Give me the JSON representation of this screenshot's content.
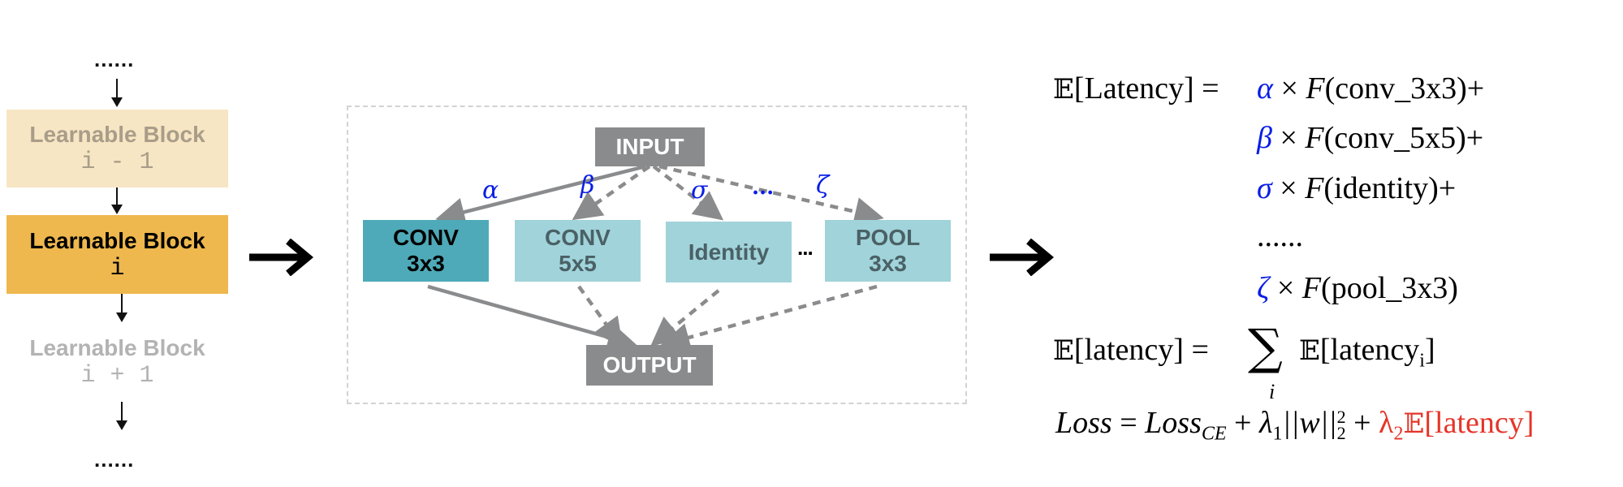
{
  "left_column": {
    "top_ellipsis": "......",
    "bottom_ellipsis": "......",
    "blocks": [
      {
        "title": "Learnable Block",
        "index": "i - 1",
        "state": "previous"
      },
      {
        "title": "Learnable Block",
        "index": "i",
        "state": "current"
      },
      {
        "title": "Learnable Block",
        "index": "i + 1",
        "state": "next"
      }
    ],
    "colors": {
      "previous_fill": "#f7e6c3",
      "current_fill": "#eeb84e"
    }
  },
  "supernet": {
    "input_label": "INPUT",
    "output_label": "OUTPUT",
    "candidate_ops": [
      {
        "line1": "CONV",
        "line2": "3x3",
        "weight_symbol": "α",
        "selected": true
      },
      {
        "line1": "CONV",
        "line2": "5x5",
        "weight_symbol": "β",
        "selected": false
      },
      {
        "line1": "Identity",
        "line2": "",
        "weight_symbol": "σ",
        "selected": false
      },
      {
        "line1": "POOL",
        "line2": "3x3",
        "weight_symbol": "ζ",
        "selected": false
      }
    ],
    "ops_ellipsis": "...",
    "weights_ellipsis": "...",
    "colors": {
      "selected_op": "#4eaab8",
      "unselected_op": "#a1d3da",
      "io_box": "#8a8b8d",
      "edge": "#8a8b8d",
      "weight_text": "#0a1ee6"
    }
  },
  "formulas": {
    "latency_expectation": {
      "lhs_bb": "𝔼",
      "lhs_text": "[Latency] =",
      "terms": [
        {
          "coef": "α",
          "op": "× ",
          "fn": "F",
          "arg": "(conv_3x3)+"
        },
        {
          "coef": "β",
          "op": "× ",
          "fn": "F",
          "arg": "(conv_5x5)+"
        },
        {
          "coef": "σ",
          "op": "× ",
          "fn": "F",
          "arg": "(identity)+"
        },
        {
          "ellipsis": "......"
        },
        {
          "coef": "ζ",
          "op": "× ",
          "fn": "F",
          "arg": "(pool_3x3)"
        }
      ]
    },
    "total_latency": {
      "lhs_bb": "𝔼",
      "lhs_text": "[latency] =",
      "sum_symbol": "∑",
      "sum_index": "i",
      "rhs_bb": "𝔼",
      "rhs_text": "[latency",
      "rhs_sub": "i",
      "rhs_close": "]"
    },
    "loss": {
      "lhs": "Loss",
      "eq": " = ",
      "ce": "Loss",
      "ce_sub": "CE",
      "plus1": " + ",
      "lambda1": "λ",
      "lambda1_sub": "1",
      "norm": "||w||",
      "norm_sup": "2",
      "norm_sub": "2",
      "plus2": " + ",
      "lambda2": "λ",
      "lambda2_sub": "2",
      "lat_bb": "𝔼",
      "lat_text": "[latency]",
      "highlight_color": "#e53428"
    }
  }
}
